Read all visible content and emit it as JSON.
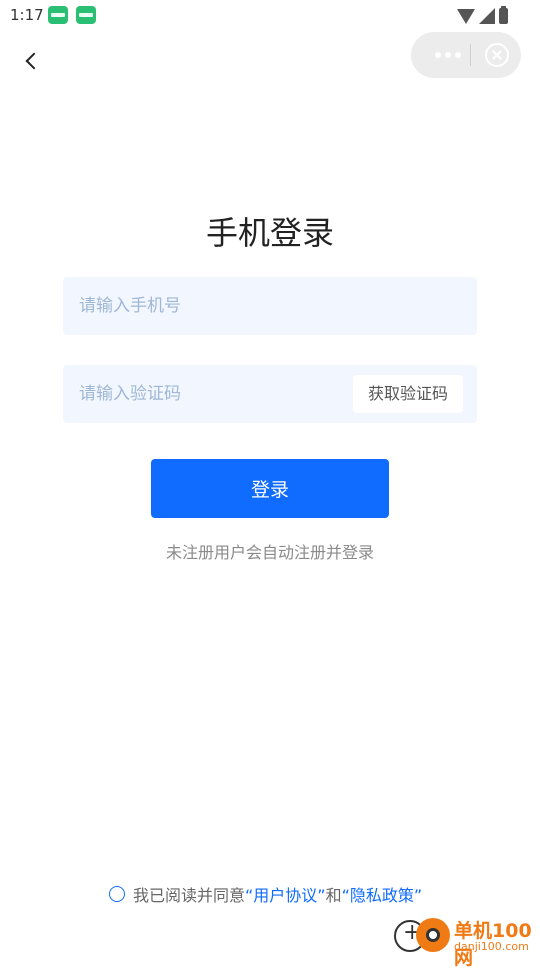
{
  "status_bar": {
    "time": "1:17",
    "icons": [
      "app-icon",
      "app-icon",
      "wifi-icon",
      "signal-icon",
      "battery-icon"
    ]
  },
  "nav": {
    "back_icon": "chevron-left-icon",
    "capsule": {
      "more_icon": "more-dots-icon",
      "close_icon": "close-circle-icon"
    }
  },
  "page": {
    "title": "手机登录",
    "phone_input": {
      "placeholder": "请输入手机号",
      "value": ""
    },
    "code_input": {
      "placeholder": "请输入验证码",
      "value": ""
    },
    "get_code_label": "获取验证码",
    "login_label": "登录",
    "hint": "未注册用户会自动注册并登录"
  },
  "agreement": {
    "prefix": "我已阅读并同意",
    "user_agreement": "“用户协议”",
    "conjunction": "和",
    "privacy_policy": "“隐私政策”"
  },
  "watermark": {
    "name": "单机100网",
    "url": "danji100.com"
  },
  "colors": {
    "primary": "#106bff",
    "field_bg": "#f2f6fe",
    "placeholder": "#9fb7d6",
    "watermark": "#f07a14"
  }
}
